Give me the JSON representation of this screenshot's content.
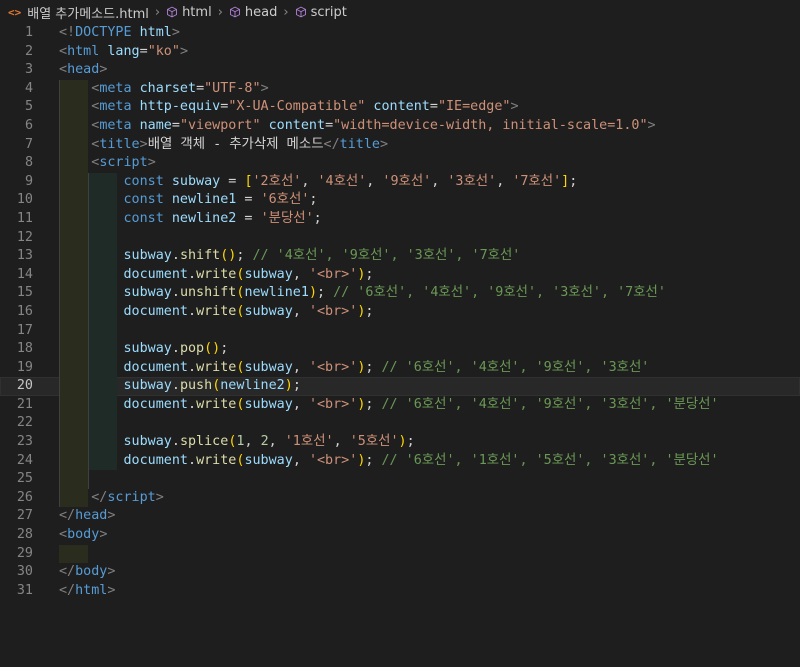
{
  "breadcrumb": {
    "file_icon": "<>",
    "file": "배열 추가메소드.html",
    "items": [
      "html",
      "head",
      "script"
    ]
  },
  "editor": {
    "current_line": 20,
    "lines": [
      {
        "n": "1",
        "indent": 0,
        "guides": 0,
        "tokens": [
          [
            "tg",
            "<!"
          ],
          [
            "tn",
            "DOCTYPE"
          ],
          [
            "at",
            " html"
          ],
          [
            "tg",
            ">"
          ]
        ]
      },
      {
        "n": "2",
        "indent": 0,
        "guides": 0,
        "tokens": [
          [
            "tg",
            "<"
          ],
          [
            "tn",
            "html"
          ],
          [
            "at",
            " lang"
          ],
          [
            "pn",
            "="
          ],
          [
            "st",
            "\"ko\""
          ],
          [
            "tg",
            ">"
          ]
        ]
      },
      {
        "n": "3",
        "indent": 0,
        "guides": 0,
        "tokens": [
          [
            "tg",
            "<"
          ],
          [
            "tn",
            "head"
          ],
          [
            "tg",
            ">"
          ]
        ]
      },
      {
        "n": "4",
        "indent": 1,
        "guides": 1,
        "tokens": [
          [
            "tx",
            "    "
          ],
          [
            "tg",
            "<"
          ],
          [
            "tn",
            "meta"
          ],
          [
            "at",
            " charset"
          ],
          [
            "pn",
            "="
          ],
          [
            "st",
            "\"UTF-8\""
          ],
          [
            "tg",
            ">"
          ]
        ]
      },
      {
        "n": "5",
        "indent": 1,
        "guides": 1,
        "tokens": [
          [
            "tx",
            "    "
          ],
          [
            "tg",
            "<"
          ],
          [
            "tn",
            "meta"
          ],
          [
            "at",
            " http-equiv"
          ],
          [
            "pn",
            "="
          ],
          [
            "st",
            "\"X-UA-Compatible\""
          ],
          [
            "at",
            " content"
          ],
          [
            "pn",
            "="
          ],
          [
            "st",
            "\"IE=edge\""
          ],
          [
            "tg",
            ">"
          ]
        ]
      },
      {
        "n": "6",
        "indent": 1,
        "guides": 1,
        "tokens": [
          [
            "tx",
            "    "
          ],
          [
            "tg",
            "<"
          ],
          [
            "tn",
            "meta"
          ],
          [
            "at",
            " name"
          ],
          [
            "pn",
            "="
          ],
          [
            "st",
            "\"viewport\""
          ],
          [
            "at",
            " content"
          ],
          [
            "pn",
            "="
          ],
          [
            "st",
            "\"width=device-width, initial-scale=1.0\""
          ],
          [
            "tg",
            ">"
          ]
        ]
      },
      {
        "n": "7",
        "indent": 1,
        "guides": 1,
        "tokens": [
          [
            "tx",
            "    "
          ],
          [
            "tg",
            "<"
          ],
          [
            "tn",
            "title"
          ],
          [
            "tg",
            ">"
          ],
          [
            "tx",
            "배열 객체 - 추가삭제 메소드"
          ],
          [
            "tg",
            "</"
          ],
          [
            "tn",
            "title"
          ],
          [
            "tg",
            ">"
          ]
        ]
      },
      {
        "n": "8",
        "indent": 1,
        "guides": 1,
        "tokens": [
          [
            "tx",
            "    "
          ],
          [
            "tg",
            "<"
          ],
          [
            "tn",
            "script"
          ],
          [
            "tg",
            ">"
          ]
        ]
      },
      {
        "n": "9",
        "indent": 2,
        "guides": 2,
        "tokens": [
          [
            "tx",
            "        "
          ],
          [
            "kw",
            "const"
          ],
          [
            "vr",
            " subway"
          ],
          [
            "pn",
            " = "
          ],
          [
            "br",
            "["
          ],
          [
            "st",
            "'2호선'"
          ],
          [
            "pn",
            ", "
          ],
          [
            "st",
            "'4호선'"
          ],
          [
            "pn",
            ", "
          ],
          [
            "st",
            "'9호선'"
          ],
          [
            "pn",
            ", "
          ],
          [
            "st",
            "'3호선'"
          ],
          [
            "pn",
            ", "
          ],
          [
            "st",
            "'7호선'"
          ],
          [
            "br",
            "]"
          ],
          [
            "pn",
            ";"
          ]
        ]
      },
      {
        "n": "10",
        "indent": 2,
        "guides": 2,
        "tokens": [
          [
            "tx",
            "        "
          ],
          [
            "kw",
            "const"
          ],
          [
            "vr",
            " newline1"
          ],
          [
            "pn",
            " = "
          ],
          [
            "st",
            "'6호선'"
          ],
          [
            "pn",
            ";"
          ]
        ]
      },
      {
        "n": "11",
        "indent": 2,
        "guides": 2,
        "tokens": [
          [
            "tx",
            "        "
          ],
          [
            "kw",
            "const"
          ],
          [
            "vr",
            " newline2"
          ],
          [
            "pn",
            " = "
          ],
          [
            "st",
            "'분당선'"
          ],
          [
            "pn",
            ";"
          ]
        ]
      },
      {
        "n": "12",
        "indent": 2,
        "guides": 2,
        "tokens": []
      },
      {
        "n": "13",
        "indent": 2,
        "guides": 2,
        "tokens": [
          [
            "tx",
            "        "
          ],
          [
            "vr",
            "subway"
          ],
          [
            "pn",
            "."
          ],
          [
            "fn",
            "shift"
          ],
          [
            "br",
            "()"
          ],
          [
            "pn",
            "; "
          ],
          [
            "cm",
            "// '4호선', '9호선', '3호선', '7호선'"
          ]
        ]
      },
      {
        "n": "14",
        "indent": 2,
        "guides": 2,
        "tokens": [
          [
            "tx",
            "        "
          ],
          [
            "vr",
            "document"
          ],
          [
            "pn",
            "."
          ],
          [
            "fn",
            "write"
          ],
          [
            "br",
            "("
          ],
          [
            "vr",
            "subway"
          ],
          [
            "pn",
            ", "
          ],
          [
            "st",
            "'<br>'"
          ],
          [
            "br",
            ")"
          ],
          [
            "pn",
            ";"
          ]
        ]
      },
      {
        "n": "15",
        "indent": 2,
        "guides": 2,
        "tokens": [
          [
            "tx",
            "        "
          ],
          [
            "vr",
            "subway"
          ],
          [
            "pn",
            "."
          ],
          [
            "fn",
            "unshift"
          ],
          [
            "br",
            "("
          ],
          [
            "vr",
            "newline1"
          ],
          [
            "br",
            ")"
          ],
          [
            "pn",
            "; "
          ],
          [
            "cm",
            "// '6호선', '4호선', '9호선', '3호선', '7호선'"
          ]
        ]
      },
      {
        "n": "16",
        "indent": 2,
        "guides": 2,
        "tokens": [
          [
            "tx",
            "        "
          ],
          [
            "vr",
            "document"
          ],
          [
            "pn",
            "."
          ],
          [
            "fn",
            "write"
          ],
          [
            "br",
            "("
          ],
          [
            "vr",
            "subway"
          ],
          [
            "pn",
            ", "
          ],
          [
            "st",
            "'<br>'"
          ],
          [
            "br",
            ")"
          ],
          [
            "pn",
            ";"
          ]
        ]
      },
      {
        "n": "17",
        "indent": 2,
        "guides": 2,
        "tokens": []
      },
      {
        "n": "18",
        "indent": 2,
        "guides": 2,
        "tokens": [
          [
            "tx",
            "        "
          ],
          [
            "vr",
            "subway"
          ],
          [
            "pn",
            "."
          ],
          [
            "fn",
            "pop"
          ],
          [
            "br",
            "()"
          ],
          [
            "pn",
            ";"
          ]
        ]
      },
      {
        "n": "19",
        "indent": 2,
        "guides": 2,
        "tokens": [
          [
            "tx",
            "        "
          ],
          [
            "vr",
            "document"
          ],
          [
            "pn",
            "."
          ],
          [
            "fn",
            "write"
          ],
          [
            "br",
            "("
          ],
          [
            "vr",
            "subway"
          ],
          [
            "pn",
            ", "
          ],
          [
            "st",
            "'<br>'"
          ],
          [
            "br",
            ")"
          ],
          [
            "pn",
            "; "
          ],
          [
            "cm",
            "// '6호선', '4호선', '9호선', '3호선'"
          ]
        ]
      },
      {
        "n": "20",
        "indent": 2,
        "guides": 2,
        "tokens": [
          [
            "tx",
            "        "
          ],
          [
            "vr",
            "subway"
          ],
          [
            "pn",
            "."
          ],
          [
            "fn",
            "push"
          ],
          [
            "br",
            "("
          ],
          [
            "vr",
            "newline2"
          ],
          [
            "br",
            ")"
          ],
          [
            "pn",
            ";"
          ]
        ]
      },
      {
        "n": "21",
        "indent": 2,
        "guides": 2,
        "tokens": [
          [
            "tx",
            "        "
          ],
          [
            "vr",
            "document"
          ],
          [
            "pn",
            "."
          ],
          [
            "fn",
            "write"
          ],
          [
            "br",
            "("
          ],
          [
            "vr",
            "subway"
          ],
          [
            "pn",
            ", "
          ],
          [
            "st",
            "'<br>'"
          ],
          [
            "br",
            ")"
          ],
          [
            "pn",
            "; "
          ],
          [
            "cm",
            "// '6호선', '4호선', '9호선', '3호선', '분당선'"
          ]
        ]
      },
      {
        "n": "22",
        "indent": 2,
        "guides": 2,
        "tokens": []
      },
      {
        "n": "23",
        "indent": 2,
        "guides": 2,
        "tokens": [
          [
            "tx",
            "        "
          ],
          [
            "vr",
            "subway"
          ],
          [
            "pn",
            "."
          ],
          [
            "fn",
            "splice"
          ],
          [
            "br",
            "("
          ],
          [
            "nm",
            "1"
          ],
          [
            "pn",
            ", "
          ],
          [
            "nm",
            "2"
          ],
          [
            "pn",
            ", "
          ],
          [
            "st",
            "'1호선'"
          ],
          [
            "pn",
            ", "
          ],
          [
            "st",
            "'5호선'"
          ],
          [
            "br",
            ")"
          ],
          [
            "pn",
            ";"
          ]
        ]
      },
      {
        "n": "24",
        "indent": 2,
        "guides": 2,
        "tokens": [
          [
            "tx",
            "        "
          ],
          [
            "vr",
            "document"
          ],
          [
            "pn",
            "."
          ],
          [
            "fn",
            "write"
          ],
          [
            "br",
            "("
          ],
          [
            "vr",
            "subway"
          ],
          [
            "pn",
            ", "
          ],
          [
            "st",
            "'<br>'"
          ],
          [
            "br",
            ")"
          ],
          [
            "pn",
            "; "
          ],
          [
            "cm",
            "// '6호선', '1호선', '5호선', '3호선', '분당선'"
          ]
        ]
      },
      {
        "n": "25",
        "indent": 1,
        "guides": 2,
        "tokens": []
      },
      {
        "n": "26",
        "indent": 1,
        "guides": 1,
        "tokens": [
          [
            "tx",
            "    "
          ],
          [
            "tg",
            "</"
          ],
          [
            "tn",
            "script"
          ],
          [
            "tg",
            ">"
          ]
        ]
      },
      {
        "n": "27",
        "indent": 0,
        "guides": 0,
        "tokens": [
          [
            "tg",
            "</"
          ],
          [
            "tn",
            "head"
          ],
          [
            "tg",
            ">"
          ]
        ]
      },
      {
        "n": "28",
        "indent": 0,
        "guides": 0,
        "tokens": [
          [
            "tg",
            "<"
          ],
          [
            "tn",
            "body"
          ],
          [
            "tg",
            ">"
          ]
        ]
      },
      {
        "n": "29",
        "indent": 1,
        "guides": 0,
        "tokens": []
      },
      {
        "n": "30",
        "indent": 0,
        "guides": 0,
        "tokens": [
          [
            "tg",
            "</"
          ],
          [
            "tn",
            "body"
          ],
          [
            "tg",
            ">"
          ]
        ]
      },
      {
        "n": "31",
        "indent": 0,
        "guides": 0,
        "tokens": [
          [
            "tg",
            "</"
          ],
          [
            "tn",
            "html"
          ],
          [
            "tg",
            ">"
          ]
        ]
      }
    ]
  }
}
